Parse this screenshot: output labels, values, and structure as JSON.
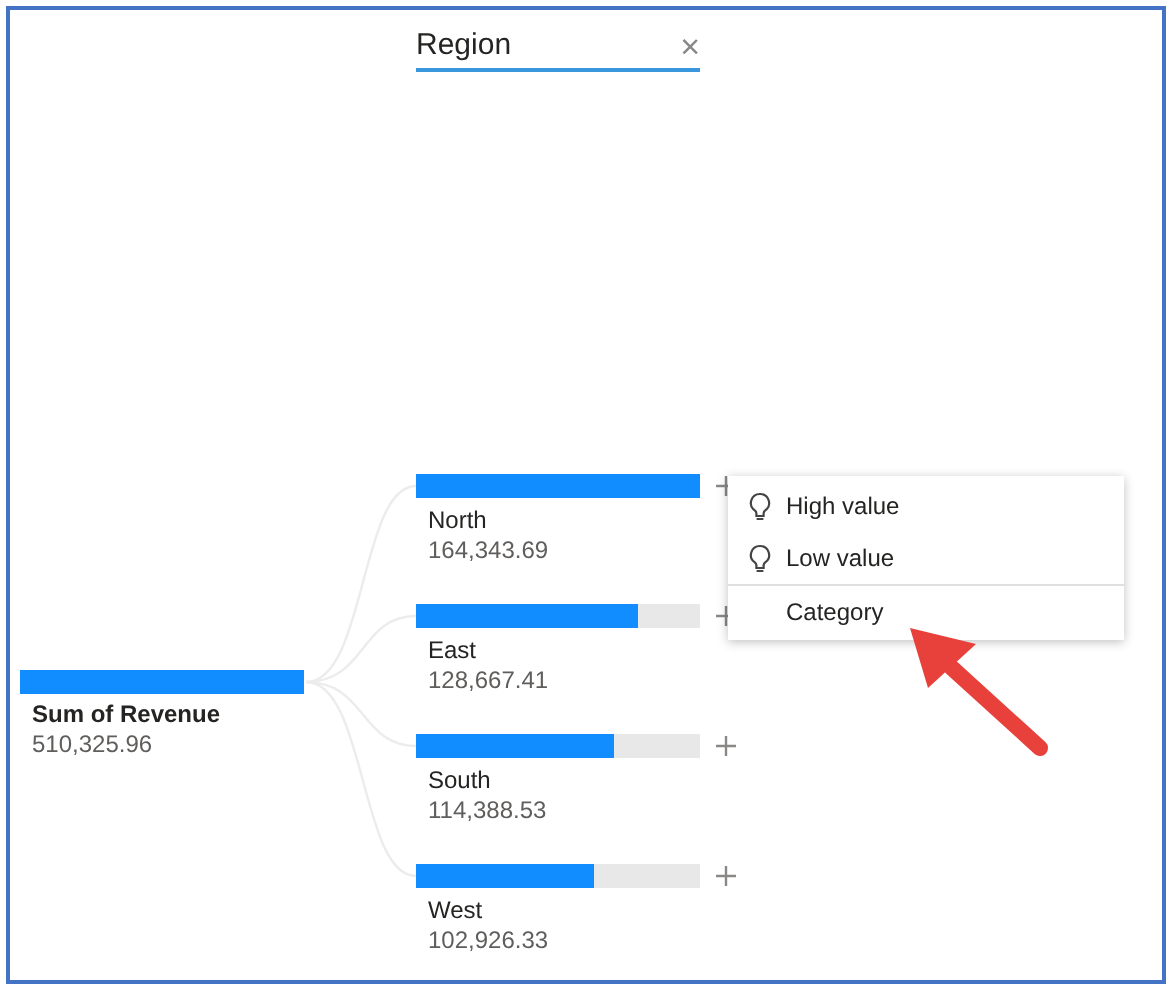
{
  "level_header": {
    "title": "Region",
    "close": "×"
  },
  "root": {
    "label": "Sum of Revenue",
    "value": "510,325.96",
    "level": 1
  },
  "nodes": [
    {
      "label": "North",
      "value": "164,343.69",
      "level": 1
    },
    {
      "label": "East",
      "value": "128,667.41",
      "level": 0.783
    },
    {
      "label": "South",
      "value": "114,388.53",
      "level": 0.696
    },
    {
      "label": "West",
      "value": "102,926.33",
      "level": 0.626
    }
  ],
  "expand_menu": {
    "items": [
      {
        "kind": "insight",
        "label": "High value"
      },
      {
        "kind": "insight",
        "label": "Low value"
      },
      {
        "kind": "field",
        "label": "Category"
      }
    ]
  }
}
